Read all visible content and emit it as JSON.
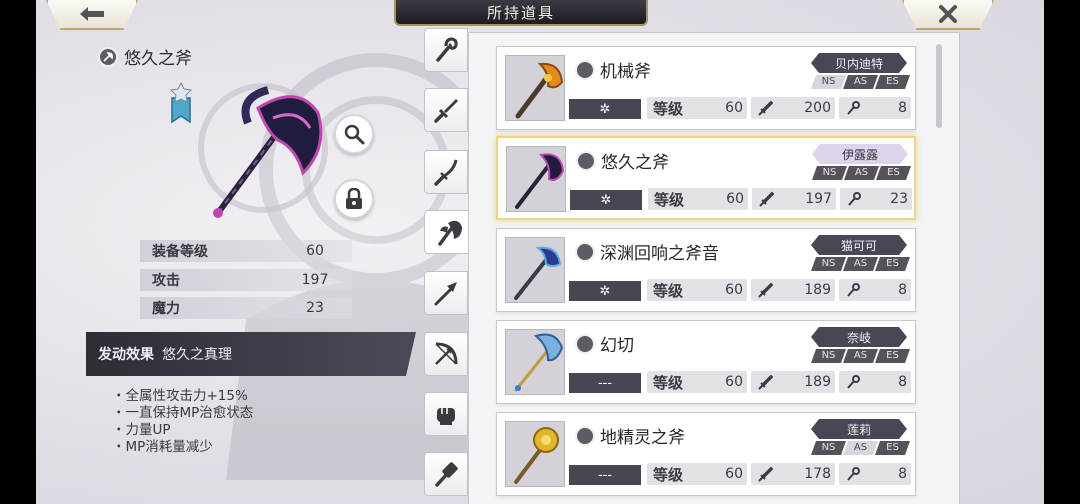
{
  "header": {
    "title": "所持道具",
    "back_icon": "back-arrow-icon",
    "close_icon": "close-x-icon"
  },
  "selected_item": {
    "name": "悠久之斧",
    "stats": [
      {
        "label": "装备等级",
        "value": "60"
      },
      {
        "label": "攻击",
        "value": "197"
      },
      {
        "label": "魔力",
        "value": "23"
      }
    ],
    "effect_header": "发动效果",
    "effect_name": "悠久之真理",
    "effects": [
      "・全属性攻击力+15%",
      "・一直保持MP治愈状态",
      "・力量UP",
      "・MP消耗量减少"
    ]
  },
  "category_tabs": [
    {
      "name": "staff",
      "icon": "staff-icon",
      "active": false
    },
    {
      "name": "sword",
      "icon": "sword-icon",
      "active": false
    },
    {
      "name": "katana",
      "icon": "katana-icon",
      "active": false
    },
    {
      "name": "axe",
      "icon": "axe-icon",
      "active": true
    },
    {
      "name": "spear",
      "icon": "spear-icon",
      "active": false
    },
    {
      "name": "bow",
      "icon": "bow-icon",
      "active": false
    },
    {
      "name": "fist",
      "icon": "fist-icon",
      "active": false
    },
    {
      "name": "hammer",
      "icon": "hammer-icon",
      "active": false
    }
  ],
  "list_labels": {
    "level": "等级"
  },
  "items": [
    {
      "name": "机械斧",
      "character": "贝内迪特",
      "effect": "✲",
      "level": "60",
      "attack": "200",
      "magic": "8",
      "tags": [
        "NS",
        "AS",
        "ES"
      ],
      "tags_on": [
        1,
        0,
        0
      ],
      "selected": false
    },
    {
      "name": "悠久之斧",
      "character": "伊露露",
      "effect": "✲",
      "level": "60",
      "attack": "197",
      "magic": "23",
      "tags": [
        "NS",
        "AS",
        "ES"
      ],
      "tags_on": [
        0,
        0,
        0
      ],
      "selected": true
    },
    {
      "name": "深渊回响之斧音",
      "character": "猫可可",
      "effect": "✲",
      "level": "60",
      "attack": "189",
      "magic": "8",
      "tags": [
        "NS",
        "AS",
        "ES"
      ],
      "tags_on": [
        0,
        0,
        0
      ],
      "selected": false
    },
    {
      "name": "幻切",
      "character": "奈岐",
      "effect": "---",
      "level": "60",
      "attack": "189",
      "magic": "8",
      "tags": [
        "NS",
        "AS",
        "ES"
      ],
      "tags_on": [
        0,
        0,
        0
      ],
      "selected": false
    },
    {
      "name": "地精灵之斧",
      "character": "莲莉",
      "effect": "---",
      "level": "60",
      "attack": "178",
      "magic": "8",
      "tags": [
        "NS",
        "AS",
        "ES"
      ],
      "tags_on": [
        0,
        1,
        0
      ],
      "selected": false
    }
  ],
  "colors": {
    "accent_gold": "#ecd58a",
    "dark_panel": "#2f2c36",
    "badge_purple": "#4b4554"
  }
}
